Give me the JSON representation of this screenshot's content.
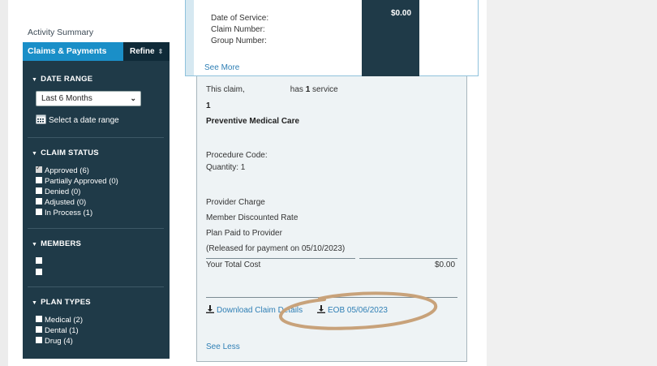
{
  "sidebar": {
    "activity_summary": "Activity Summary",
    "tab_claims": "Claims & Payments",
    "refine": "Refine",
    "refine_icon": "chevron-updown-icon",
    "date_range": {
      "title": "DATE RANGE",
      "selected": "Last 6 Months",
      "select_date_link": "Select a date range"
    },
    "claim_status": {
      "title": "CLAIM STATUS",
      "options": [
        {
          "label": "Approved (6)",
          "checked": true
        },
        {
          "label": "Partially Approved (0)",
          "checked": false
        },
        {
          "label": "Denied (0)",
          "checked": false
        },
        {
          "label": "Adjusted (0)",
          "checked": false
        },
        {
          "label": "In Process (1)",
          "checked": false
        }
      ]
    },
    "members": {
      "title": "MEMBERS",
      "options": [
        {
          "label": "",
          "checked": false
        },
        {
          "label": "",
          "checked": false
        }
      ]
    },
    "plan_types": {
      "title": "PLAN TYPES",
      "options": [
        {
          "label": "Medical (2)",
          "checked": false
        },
        {
          "label": "Dental (1)",
          "checked": false
        },
        {
          "label": "Drug (4)",
          "checked": false
        }
      ]
    }
  },
  "claim_summary": {
    "date_of_service": "Date of Service:",
    "claim_number": "Claim Number:",
    "group_number": "Group Number:",
    "total": "$0.00",
    "see_more": "See More"
  },
  "claim_detail": {
    "intro_prefix": "This claim,",
    "intro_mid": "has",
    "service_count": "1",
    "intro_suffix": "service",
    "service_index": "1",
    "service_name": "Preventive Medical Care",
    "procedure_code": "Procedure Code:",
    "quantity": "Quantity: 1",
    "provider_charge": "Provider Charge",
    "member_discounted_rate": "Member Discounted Rate",
    "plan_paid": "Plan Paid to Provider",
    "released": "(Released for payment on 05/10/2023)",
    "your_total_cost": "Your Total Cost",
    "your_total_cost_value": "$0.00",
    "download_claim_details": "Download Claim Details",
    "eob": "EOB 05/06/2023",
    "see_less": "See Less"
  },
  "colors": {
    "panel": "#1f3a48",
    "tab_active": "#1a8fc8",
    "link": "#2f7fb5",
    "highlight_circle": "#c8a27a"
  }
}
